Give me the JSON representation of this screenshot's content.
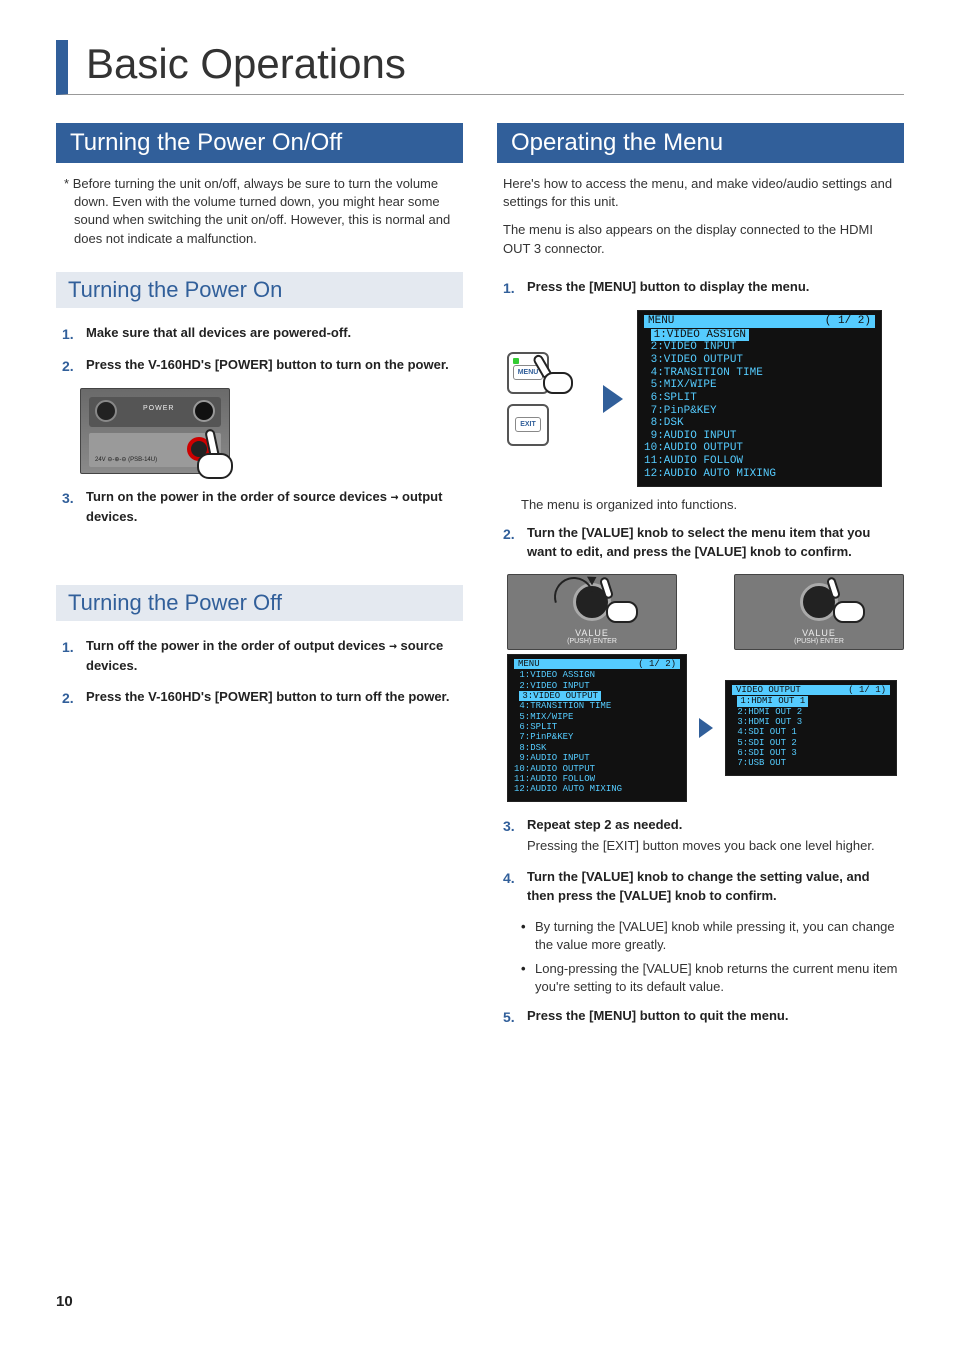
{
  "page_number": "10",
  "chapter_title": "Basic Operations",
  "left": {
    "heading": "Turning the Power On/Off",
    "note_prefix": "*",
    "note_text": "Before turning the unit on/off, always be sure to turn the volume down. Even with the volume turned down, you might hear some sound when switching the unit on/off. However, this is normal and does not indicate a malfunction.",
    "sub1": {
      "title": "Turning the Power On",
      "steps": [
        {
          "num": "1.",
          "bold": "Make sure that all devices are powered-off."
        },
        {
          "num": "2.",
          "bold": "Press the V-160HD's [POWER] button to turn on the power."
        },
        {
          "num": "3.",
          "bold_a": "Turn on the power in the order of source devices ",
          "arrow": "→",
          "bold_b": " output devices."
        }
      ],
      "power_label": "POWER",
      "power_small": "24V\n⊖-⊕-⊖\n(PSB-14U)"
    },
    "sub2": {
      "title": "Turning the Power Off",
      "steps": [
        {
          "num": "1.",
          "bold_a": "Turn off the power in the order of output devices ",
          "arrow": "→",
          "bold_b": " source devices."
        },
        {
          "num": "2.",
          "bold": "Press the V-160HD's [POWER] button to turn off the power."
        }
      ]
    }
  },
  "right": {
    "heading": "Operating the Menu",
    "intro1": "Here's how to access the menu, and make video/audio settings and settings for this unit.",
    "intro2": "The menu is also appears on the display connected to the HDMI OUT 3 connector.",
    "step1": {
      "num": "1.",
      "bold": "Press the [MENU] button to display the menu."
    },
    "btn_menu": "MENU",
    "btn_exit": "EXIT",
    "lcd1": {
      "title": "MENU",
      "page": "( 1/ 2)",
      "highlight": "1:VIDEO ASSIGN",
      "lines": " 2:VIDEO INPUT\n 3:VIDEO OUTPUT\n 4:TRANSITION TIME\n 5:MIX/WIPE\n 6:SPLIT\n 7:PinP&KEY\n 8:DSK\n 9:AUDIO INPUT\n10:AUDIO OUTPUT\n11:AUDIO FOLLOW\n12:AUDIO AUTO MIXING"
    },
    "caption1": "The menu is organized into functions.",
    "step2": {
      "num": "2.",
      "bold": "Turn the [VALUE] knob to select the menu item that you want to edit, and press the [VALUE] knob to confirm."
    },
    "knob_label": "VALUE",
    "knob_sub": "(PUSH) ENTER",
    "lcd2": {
      "title": "MENU",
      "page": "( 1/ 2)",
      "pre": " 1:VIDEO ASSIGN\n 2:VIDEO INPUT",
      "highlight": "3:VIDEO OUTPUT",
      "post": " 4:TRANSITION TIME\n 5:MIX/WIPE\n 6:SPLIT\n 7:PinP&KEY\n 8:DSK\n 9:AUDIO INPUT\n10:AUDIO OUTPUT\n11:AUDIO FOLLOW\n12:AUDIO AUTO MIXING"
    },
    "lcd3": {
      "title": "VIDEO OUTPUT",
      "page": "( 1/ 1)",
      "highlight": "1:HDMI OUT 1",
      "post": " 2:HDMI OUT 2\n 3:HDMI OUT 3\n 4:SDI OUT 1\n 5:SDI OUT 2\n 6:SDI OUT 3\n 7:USB OUT"
    },
    "step3": {
      "num": "3.",
      "bold": "Repeat step 2 as needed.",
      "plain": "Pressing the [EXIT] button moves you back one level higher."
    },
    "step4": {
      "num": "4.",
      "bold": "Turn the [VALUE] knob to change the setting value, and then press the [VALUE] knob to confirm."
    },
    "bullets": [
      "By turning the [VALUE] knob while pressing it, you can change the value more greatly.",
      "Long-pressing the [VALUE] knob returns the current menu item you're setting to its default value."
    ],
    "step5": {
      "num": "5.",
      "bold": "Press the [MENU] button to quit the menu."
    }
  }
}
